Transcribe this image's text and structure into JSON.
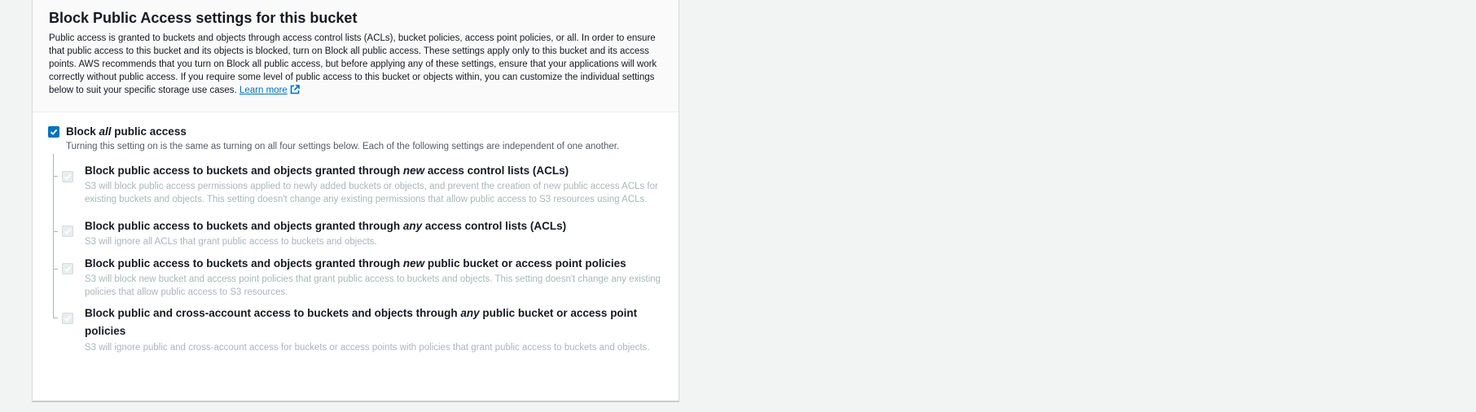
{
  "section": {
    "title": "Block Public Access settings for this bucket",
    "description": "Public access is granted to buckets and objects through access control lists (ACLs), bucket policies, access point policies, or all. In order to ensure that public access to this bucket and its objects is blocked, turn on Block all public access. These settings apply only to this bucket and its access points. AWS recommends that you turn on Block all public access, but before applying any of these settings, ensure that your applications will work correctly without public access. If you require some level of public access to this bucket or objects within, you can customize the individual settings below to suit your specific storage use cases.",
    "learn_more": "Learn more"
  },
  "block_all": {
    "label_prefix": "Block ",
    "label_em": "all",
    "label_suffix": " public access",
    "checked": true,
    "description": "Turning this setting on is the same as turning on all four settings below. Each of the following settings are independent of one another."
  },
  "settings": [
    {
      "title_prefix": "Block public access to buckets and objects granted through ",
      "title_em": "new",
      "title_suffix": " access control lists (ACLs)",
      "description": "S3 will block public access permissions applied to newly added buckets or objects, and prevent the creation of new public access ACLs for existing buckets and objects. This setting doesn't change any existing permissions that allow public access to S3 resources using ACLs.",
      "checked": true
    },
    {
      "title_prefix": "Block public access to buckets and objects granted through ",
      "title_em": "any",
      "title_suffix": " access control lists (ACLs)",
      "description": "S3 will ignore all ACLs that grant public access to buckets and objects.",
      "checked": true
    },
    {
      "title_prefix": "Block public access to buckets and objects granted through ",
      "title_em": "new",
      "title_suffix": " public bucket or access point policies",
      "description": "S3 will block new bucket and access point policies that grant public access to buckets and objects. This setting doesn't change any existing policies that allow public access to S3 resources.",
      "checked": true
    },
    {
      "title_prefix": "Block public and cross-account access to buckets and objects through ",
      "title_em": "any",
      "title_suffix": " public bucket or access point policies",
      "description": "S3 will ignore public and cross-account access for buckets or access points with policies that grant public access to buckets and objects.",
      "checked": true
    }
  ],
  "colors": {
    "accent": "#0073bb",
    "disabled_text": "#aab7b8"
  }
}
